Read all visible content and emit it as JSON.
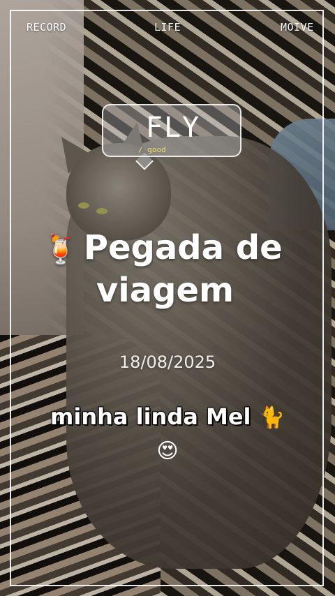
{
  "top_bar": {
    "record_label": "RECORD",
    "life_label": "LIFE",
    "moive_label": "MOIVE"
  },
  "bubble": {
    "title": "FLY",
    "subtitle": "/ good"
  },
  "headline": {
    "emoji": "🍹",
    "line1": "Pegada de",
    "line2": "viagem"
  },
  "date": "18/08/2025",
  "caption": {
    "text": "minha linda Mel",
    "emoji_cat": "🐈",
    "emoji_love": "😍"
  },
  "colors": {
    "frame": "#ffffff",
    "subtitle_accent": "#e9e06a"
  }
}
